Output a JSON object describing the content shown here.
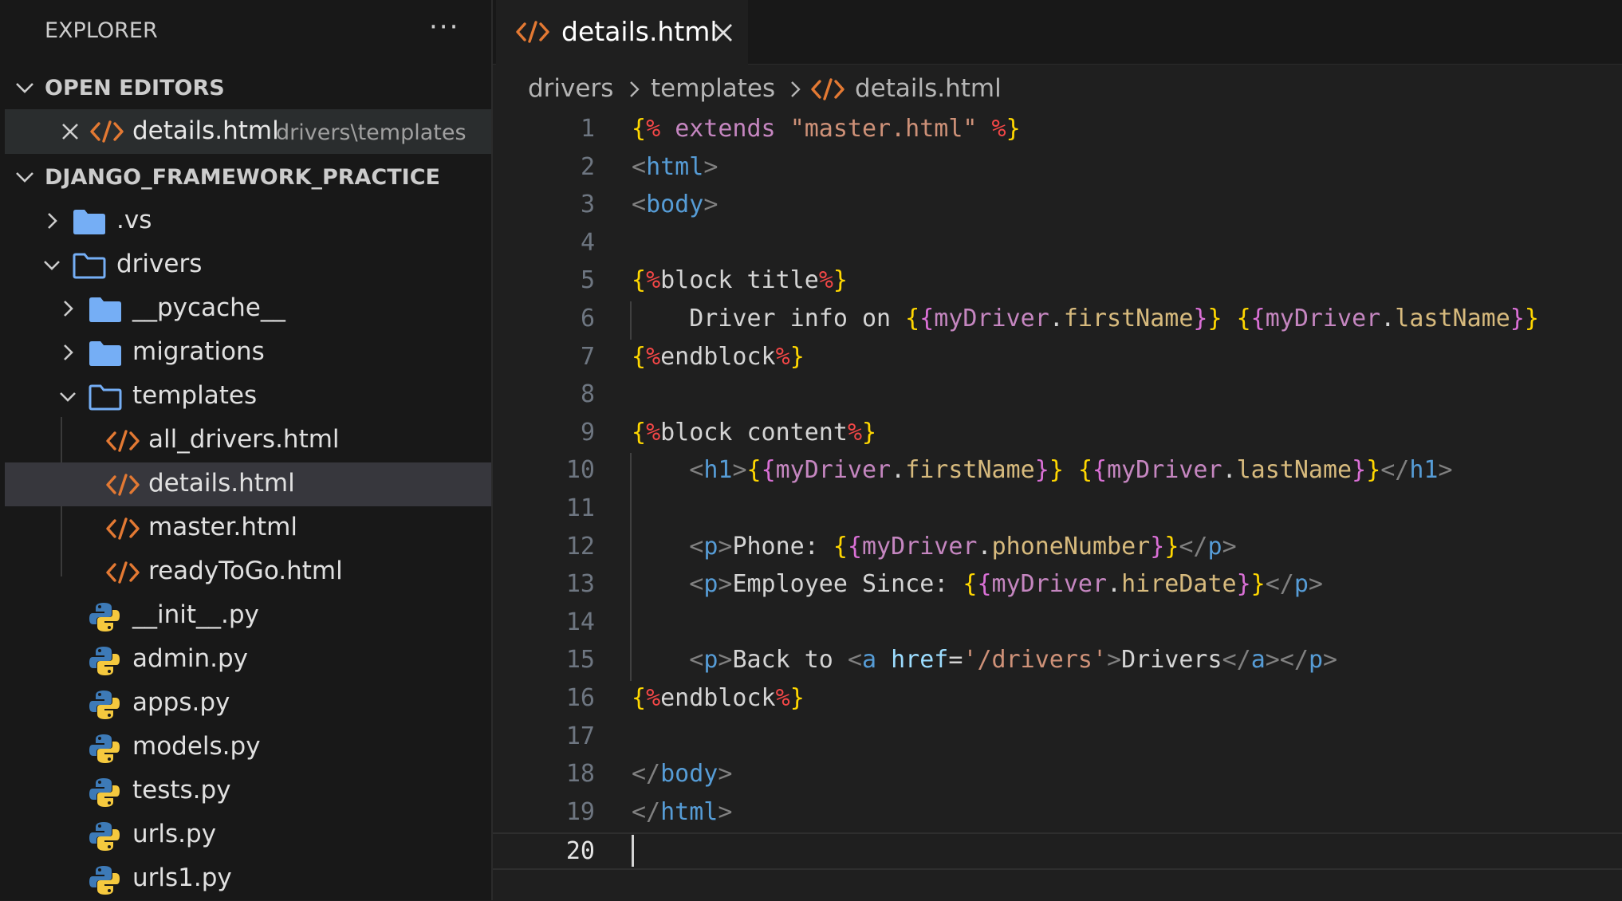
{
  "explorer": {
    "title": "EXPLORER",
    "more_icon": "ellipsis-icon",
    "open_editors_label": "OPEN EDITORS",
    "open_editors": [
      {
        "name": "details.html",
        "path": "drivers\\templates"
      }
    ],
    "project_label": "DJANGO_FRAMEWORK_PRACTICE",
    "tree": [
      {
        "label": ".vs",
        "kind": "folder",
        "expanded": false
      },
      {
        "label": "drivers",
        "kind": "folder",
        "expanded": true
      },
      {
        "label": "__pycache__",
        "kind": "folder",
        "expanded": false
      },
      {
        "label": "migrations",
        "kind": "folder",
        "expanded": false
      },
      {
        "label": "templates",
        "kind": "folder",
        "expanded": true
      },
      {
        "label": "all_drivers.html",
        "kind": "html"
      },
      {
        "label": "details.html",
        "kind": "html",
        "selected": true
      },
      {
        "label": "master.html",
        "kind": "html"
      },
      {
        "label": "readyToGo.html",
        "kind": "html"
      },
      {
        "label": "__init__.py",
        "kind": "python"
      },
      {
        "label": "admin.py",
        "kind": "python"
      },
      {
        "label": "apps.py",
        "kind": "python"
      },
      {
        "label": "models.py",
        "kind": "python"
      },
      {
        "label": "tests.py",
        "kind": "python"
      },
      {
        "label": "urls.py",
        "kind": "python"
      },
      {
        "label": "urls1.py",
        "kind": "python"
      }
    ]
  },
  "tab": {
    "label": "details.html"
  },
  "breadcrumb": {
    "parts": [
      "drivers",
      "templates",
      "details.html"
    ]
  },
  "editor": {
    "current_line": 20,
    "lines": [
      {
        "n": "1",
        "tokens": [
          [
            "{",
            "yel"
          ],
          [
            "% ",
            "pct"
          ],
          [
            "extends",
            "kw"
          ],
          [
            " ",
            "txt"
          ],
          [
            "\"master.html\"",
            "str"
          ],
          [
            " %",
            "pct"
          ],
          [
            "}",
            "yel"
          ]
        ]
      },
      {
        "n": "2",
        "tokens": [
          [
            "<",
            "br"
          ],
          [
            "html",
            "tag"
          ],
          [
            ">",
            "br"
          ]
        ]
      },
      {
        "n": "3",
        "tokens": [
          [
            "<",
            "br"
          ],
          [
            "body",
            "tag"
          ],
          [
            ">",
            "br"
          ]
        ]
      },
      {
        "n": "4",
        "tokens": []
      },
      {
        "n": "5",
        "tokens": [
          [
            "{",
            "yel"
          ],
          [
            "%",
            "pct"
          ],
          [
            "block title",
            "txt"
          ],
          [
            "%",
            "pct"
          ],
          [
            "}",
            "yel"
          ]
        ]
      },
      {
        "n": "6",
        "tokens": [
          [
            "    Driver info on ",
            "txt"
          ],
          [
            "{",
            "yel"
          ],
          [
            "{",
            "pink"
          ],
          [
            "myDriver",
            "var"
          ],
          [
            ".",
            "txt"
          ],
          [
            "firstName",
            "prop"
          ],
          [
            "}",
            "pink"
          ],
          [
            "}",
            "yel"
          ],
          [
            " ",
            "txt"
          ],
          [
            "{",
            "yel"
          ],
          [
            "{",
            "pink"
          ],
          [
            "myDriver",
            "var"
          ],
          [
            ".",
            "txt"
          ],
          [
            "lastName",
            "prop"
          ],
          [
            "}",
            "pink"
          ],
          [
            "}",
            "yel"
          ]
        ]
      },
      {
        "n": "7",
        "tokens": [
          [
            "{",
            "yel"
          ],
          [
            "%",
            "pct"
          ],
          [
            "endblock",
            "txt"
          ],
          [
            "%",
            "pct"
          ],
          [
            "}",
            "yel"
          ]
        ]
      },
      {
        "n": "8",
        "tokens": []
      },
      {
        "n": "9",
        "tokens": [
          [
            "{",
            "yel"
          ],
          [
            "%",
            "pct"
          ],
          [
            "block content",
            "txt"
          ],
          [
            "%",
            "pct"
          ],
          [
            "}",
            "yel"
          ]
        ]
      },
      {
        "n": "10",
        "tokens": [
          [
            "    ",
            "txt"
          ],
          [
            "<",
            "br"
          ],
          [
            "h1",
            "tag"
          ],
          [
            ">",
            "br"
          ],
          [
            "{",
            "yel"
          ],
          [
            "{",
            "pink"
          ],
          [
            "myDriver",
            "var"
          ],
          [
            ".",
            "txt"
          ],
          [
            "firstName",
            "prop"
          ],
          [
            "}",
            "pink"
          ],
          [
            "}",
            "yel"
          ],
          [
            " ",
            "txt"
          ],
          [
            "{",
            "yel"
          ],
          [
            "{",
            "pink"
          ],
          [
            "myDriver",
            "var"
          ],
          [
            ".",
            "txt"
          ],
          [
            "lastName",
            "prop"
          ],
          [
            "}",
            "pink"
          ],
          [
            "}",
            "yel"
          ],
          [
            "</",
            "br"
          ],
          [
            "h1",
            "tag"
          ],
          [
            ">",
            "br"
          ]
        ]
      },
      {
        "n": "11",
        "tokens": []
      },
      {
        "n": "12",
        "tokens": [
          [
            "    ",
            "txt"
          ],
          [
            "<",
            "br"
          ],
          [
            "p",
            "tag"
          ],
          [
            ">",
            "br"
          ],
          [
            "Phone: ",
            "txt"
          ],
          [
            "{",
            "yel"
          ],
          [
            "{",
            "pink"
          ],
          [
            "myDriver",
            "var"
          ],
          [
            ".",
            "txt"
          ],
          [
            "phoneNumber",
            "prop"
          ],
          [
            "}",
            "pink"
          ],
          [
            "}",
            "yel"
          ],
          [
            "</",
            "br"
          ],
          [
            "p",
            "tag"
          ],
          [
            ">",
            "br"
          ]
        ]
      },
      {
        "n": "13",
        "tokens": [
          [
            "    ",
            "txt"
          ],
          [
            "<",
            "br"
          ],
          [
            "p",
            "tag"
          ],
          [
            ">",
            "br"
          ],
          [
            "Employee Since: ",
            "txt"
          ],
          [
            "{",
            "yel"
          ],
          [
            "{",
            "pink"
          ],
          [
            "myDriver",
            "var"
          ],
          [
            ".",
            "txt"
          ],
          [
            "hireDate",
            "prop"
          ],
          [
            "}",
            "pink"
          ],
          [
            "}",
            "yel"
          ],
          [
            "</",
            "br"
          ],
          [
            "p",
            "tag"
          ],
          [
            ">",
            "br"
          ]
        ]
      },
      {
        "n": "14",
        "tokens": []
      },
      {
        "n": "15",
        "tokens": [
          [
            "    ",
            "txt"
          ],
          [
            "<",
            "br"
          ],
          [
            "p",
            "tag"
          ],
          [
            ">",
            "br"
          ],
          [
            "Back to ",
            "txt"
          ],
          [
            "<",
            "br"
          ],
          [
            "a",
            "tag"
          ],
          [
            " ",
            "txt"
          ],
          [
            "href",
            "attr"
          ],
          [
            "=",
            "txt"
          ],
          [
            "'/drivers'",
            "str"
          ],
          [
            ">",
            "br"
          ],
          [
            "Drivers",
            "txt"
          ],
          [
            "</",
            "br"
          ],
          [
            "a",
            "tag"
          ],
          [
            "></",
            "br"
          ],
          [
            "p",
            "tag"
          ],
          [
            ">",
            "br"
          ]
        ]
      },
      {
        "n": "16",
        "tokens": [
          [
            "{",
            "yel"
          ],
          [
            "%",
            "pct"
          ],
          [
            "endblock",
            "txt"
          ],
          [
            "%",
            "pct"
          ],
          [
            "}",
            "yel"
          ]
        ]
      },
      {
        "n": "17",
        "tokens": []
      },
      {
        "n": "18",
        "tokens": [
          [
            "</",
            "br"
          ],
          [
            "body",
            "tag"
          ],
          [
            ">",
            "br"
          ]
        ]
      },
      {
        "n": "19",
        "tokens": [
          [
            "</",
            "br"
          ],
          [
            "html",
            "tag"
          ],
          [
            ">",
            "br"
          ]
        ]
      },
      {
        "n": "20",
        "tokens": []
      }
    ]
  },
  "colors": {
    "html_icon": "#e37933",
    "folder": "#75aef5",
    "python_blue": "#3d7ab7",
    "python_yellow": "#f5c93e"
  }
}
